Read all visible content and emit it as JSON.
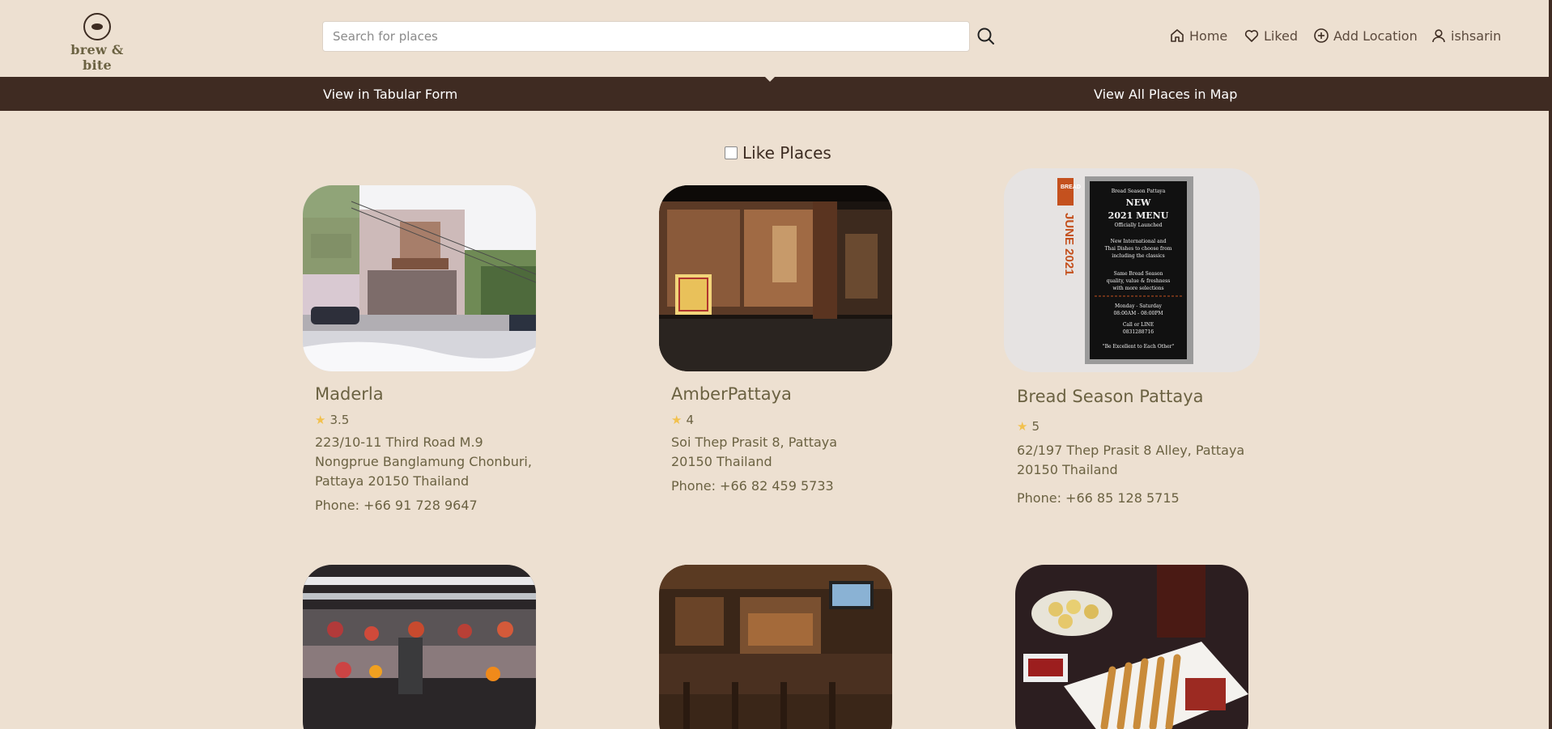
{
  "brand": {
    "name": "brew & bite"
  },
  "search": {
    "placeholder": "Search for places"
  },
  "nav": {
    "home": "Home",
    "liked": "Liked",
    "add_location": "Add Location",
    "user": "ishsarin"
  },
  "tabs": {
    "tabular": "View in Tabular Form",
    "map": "View All Places in Map"
  },
  "filter": {
    "like_label": "Like Places",
    "checked": false
  },
  "colors": {
    "background": "#ede0d1",
    "tabbar": "#3f2b22",
    "text": "#6b6242",
    "star": "#f2c14e"
  },
  "places": [
    {
      "name": "Maderla",
      "rating": "3.5",
      "address": "223/10-11 Third Road M.9 Nongprue Banglamung Chonburi, Pattaya 20150 Thailand",
      "phone": "Phone: +66 91 728 9647",
      "image": "building-street-photo"
    },
    {
      "name": "AmberPattaya",
      "rating": "4",
      "address": "Soi Thep Prasit 8, Pattaya 20150 Thailand",
      "phone": "Phone: +66 82 459 5733",
      "image": "restaurant-night-photo"
    },
    {
      "name": "Bread Season Pattaya",
      "rating": "5",
      "address": "62/197 Thep Prasit 8 Alley, Pattaya 20150 Thailand",
      "phone": "Phone: +66 85 128 5715",
      "image": "menu-board-photo",
      "menu_text": {
        "brand": "BREAD",
        "side": "JUNE 2021",
        "title": "Bread Season Pattaya",
        "new": "NEW",
        "menu": "2021 MENU",
        "launched": "Officially Launched",
        "line1": "New International and",
        "line2": "Thai Dishes to choose from",
        "line3": "including the classics",
        "line4": "Same Bread Season",
        "line5": "quality, value & freshness",
        "line6": "with more selections",
        "hours1": "Monday - Saturday",
        "hours2": "08:00AM - 08:00PM",
        "call": "Call or LINE",
        "number": "0831288716",
        "motto": "\"Be Excellent to Each Other\""
      }
    },
    {
      "name": "",
      "image": "food-display-photo"
    },
    {
      "name": "",
      "image": "pub-bar-photo"
    },
    {
      "name": "",
      "image": "satay-dinner-photo"
    }
  ]
}
